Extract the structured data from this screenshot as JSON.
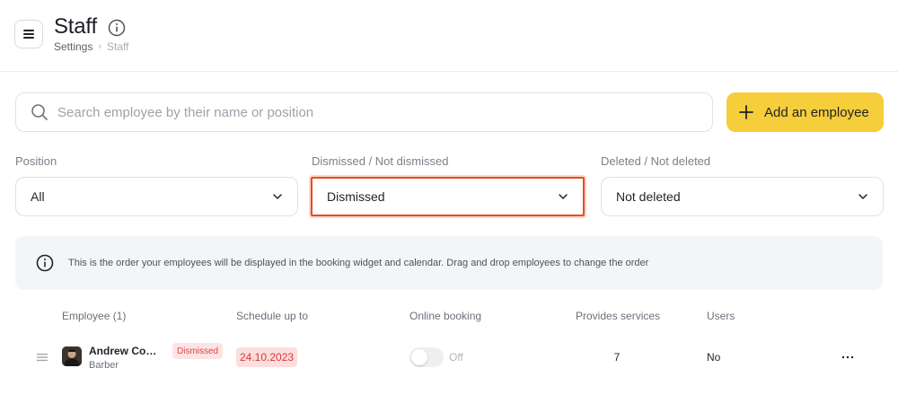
{
  "header": {
    "title": "Staff",
    "breadcrumb": [
      "Settings",
      "Staff"
    ]
  },
  "search": {
    "placeholder": "Search employee by their name or position",
    "value": ""
  },
  "add_button": {
    "label": "Add an employee"
  },
  "filters": [
    {
      "label": "Position",
      "value": "All"
    },
    {
      "label": "Dismissed / Not dismissed",
      "value": "Dismissed"
    },
    {
      "label": "Deleted / Not deleted",
      "value": "Not deleted"
    }
  ],
  "info": {
    "text": "This is the order your employees will be displayed in the booking widget and calendar. Drag and drop employees to change the order"
  },
  "table": {
    "headers": [
      "Employee (1)",
      "Schedule up to",
      "Online booking",
      "Provides services",
      "Users"
    ],
    "rows": [
      {
        "name": "Andrew Comrade",
        "role": "Barber",
        "badge": "Dismissed",
        "schedule": "24.10.2023",
        "online_booking": "Off",
        "services": "7",
        "users": "No"
      }
    ]
  },
  "colors": {
    "accent": "#f6cd3b",
    "highlight_border": "#ea4a1f",
    "danger": "#e04545",
    "info_bg": "#f4f5f8"
  },
  "icons": [
    "hamburger-menu-icon",
    "info-circle-icon",
    "search-icon",
    "plus-icon",
    "chevron-down-icon",
    "drag-handle-icon",
    "more-horizontal-icon"
  ]
}
